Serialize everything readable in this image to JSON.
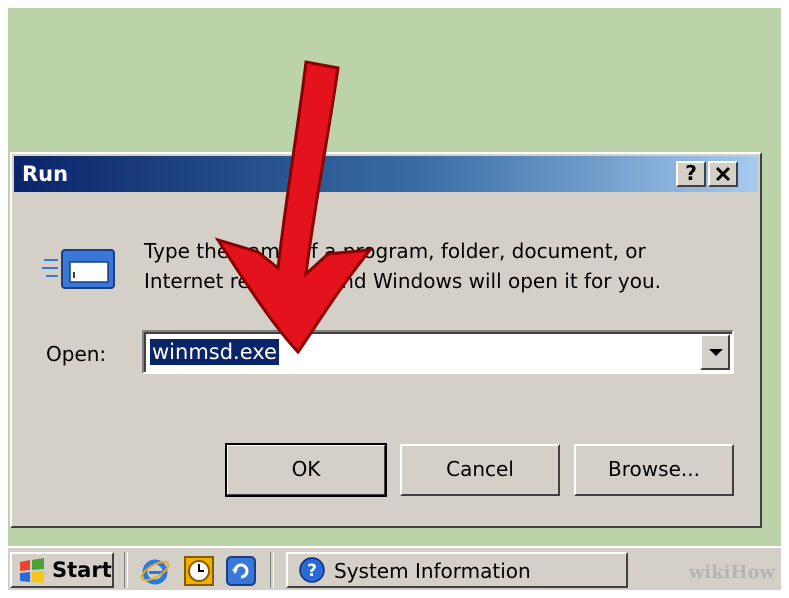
{
  "dialog": {
    "title": "Run",
    "help_button": "?",
    "close_button": "✕",
    "description": "Type the name of a program, folder, document, or Internet resource, and Windows will open it for you.",
    "open_label": "Open:",
    "open_value": "winmsd.exe",
    "ok_label": "OK",
    "cancel_label": "Cancel",
    "browse_label": "Browse..."
  },
  "taskbar": {
    "start_label": "Start",
    "quick_launch_icons": [
      "internet-explorer-icon",
      "clock-icon",
      "refresh-icon"
    ],
    "task_label": "System Information"
  },
  "watermark": "wikiHow",
  "colors": {
    "background": "#bcd2a8",
    "dialog": "#d4d0c8",
    "title_start": "#0a246a",
    "title_end": "#a6caf0",
    "selection": "#0a246a",
    "arrow": "#e3121c"
  }
}
